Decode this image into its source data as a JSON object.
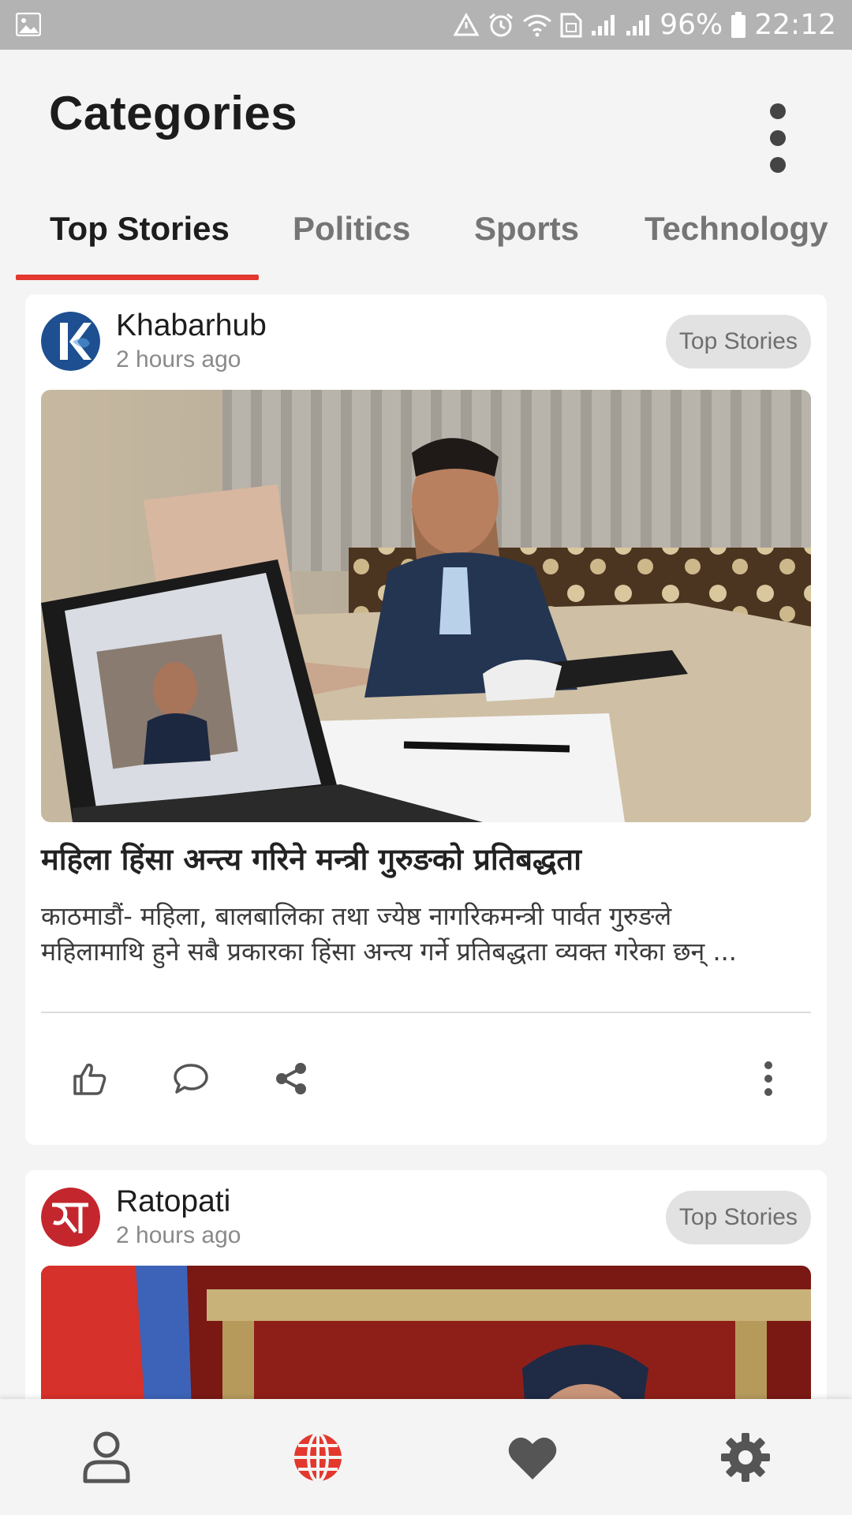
{
  "status_bar": {
    "battery": "96%",
    "time": "22:12"
  },
  "header": {
    "title": "Categories"
  },
  "tabs": [
    {
      "label": "Top Stories",
      "active": true
    },
    {
      "label": "Politics",
      "active": false
    },
    {
      "label": "Sports",
      "active": false
    },
    {
      "label": "Technology",
      "active": false
    }
  ],
  "feed": [
    {
      "source": "Khabarhub",
      "time": "2 hours ago",
      "category": "Top Stories",
      "headline": "महिला हिंसा अन्त्य गरिने मन्त्री गुरुङको प्रतिबद्धता",
      "summary_line1": "काठमाडौं- महिला, बालबालिका तथा ज्येष्ठ नागरिकमन्त्री पार्वत गुरुङले",
      "summary_line2": "महिलामाथि हुने सबै प्रकारका हिंसा अन्त्य गर्ने प्रतिबद्धता व्यक्त गरेका छन् ..."
    },
    {
      "source": "Ratopati",
      "time": "2 hours ago",
      "category": "Top Stories"
    }
  ],
  "colors": {
    "accent": "#e3382e",
    "card": "#ffffff",
    "background": "#f4f4f4",
    "chip": "#e2e2e2"
  },
  "icons": {
    "status_left": "image-icon",
    "status_right": [
      "recycle-icon",
      "alarm-icon",
      "wifi-icon",
      "sim-icon",
      "signal-icon",
      "signal-icon",
      "battery-icon"
    ],
    "card_actions": [
      "like-icon",
      "comment-icon",
      "share-icon",
      "more-vert-icon"
    ],
    "bottom_nav": [
      "profile-icon",
      "globe-icon",
      "heart-icon",
      "settings-icon"
    ]
  }
}
